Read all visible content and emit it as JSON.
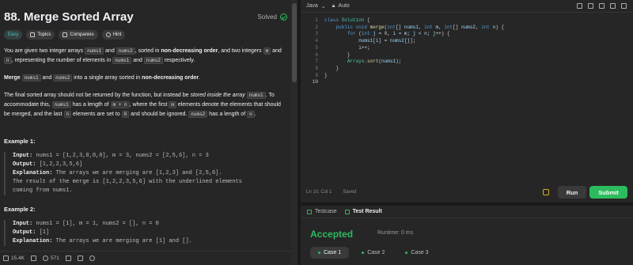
{
  "problem": {
    "title": "88. Merge Sorted Array",
    "solved_label": "Solved",
    "tags": [
      {
        "label": "Easy",
        "icon": ""
      },
      {
        "label": "Topics",
        "icon": "tag-icon"
      },
      {
        "label": "Companies",
        "icon": "building-icon"
      },
      {
        "label": "Hint",
        "icon": "lightbulb-icon"
      }
    ]
  },
  "description": {
    "p1_a": "You are given two integer arrays ",
    "p1_nums1": "nums1",
    "p1_b": " and ",
    "p1_nums2": "nums2",
    "p1_c": ", sorted in ",
    "p1_bold": "non-decreasing order",
    "p1_d": ", and two integers ",
    "p1_m": "m",
    "p1_e": " and ",
    "p1_n": "n",
    "p1_f": ", representing the number of elements in ",
    "p1_nums1b": "nums1",
    "p1_g": " and ",
    "p1_nums2b": "nums2",
    "p1_h": " respectively.",
    "p2_bold1": "Merge",
    "p2_nums1": "nums1",
    "p2_a": " and ",
    "p2_nums2": "nums2",
    "p2_bold2": " into a single array sorted in ",
    "p2_bold3": "non-decreasing order",
    "p2_end": ".",
    "p3_a": "The final sorted array should not be returned by the function, but instead be ",
    "p3_italic": "stored inside the array",
    "p3_nums1": "nums1",
    "p3_b": ". To accommodate this, ",
    "p3_nums1b": "nums1",
    "p3_c": " has a length of ",
    "p3_mn": "m + n",
    "p3_d": ", where the first ",
    "p3_m": "m",
    "p3_e": " elements denote the elements that should be merged, and the last ",
    "p3_n": "n",
    "p3_f": " elements are set to ",
    "p3_zero": "0",
    "p3_g": " and should be ignored. ",
    "p3_nums2": "nums2",
    "p3_h": " has a length of ",
    "p3_n2": "n",
    "p3_end": "."
  },
  "examples": [
    {
      "title": "Example 1:",
      "input_label": "Input:",
      "input": " nums1 = [1,2,3,0,0,0], m = 3, nums2 = [2,5,6], n = 3",
      "output_label": "Output:",
      "output": " [1,2,2,3,5,6]",
      "explanation_label": "Explanation:",
      "explanation": " The arrays we are merging are [1,2,3] and [2,5,6].",
      "explanation2": "The result of the merge is [1,2,2,3,5,6] with the underlined elements",
      "explanation3": "coming from nums1."
    },
    {
      "title": "Example 2:",
      "input_label": "Input:",
      "input": " nums1 = [1], m = 1, nums2 = [], n = 0",
      "output_label": "Output:",
      "output": " [1]",
      "explanation_label": "Explanation:",
      "explanation": " The arrays we are merging are [1] and []."
    }
  ],
  "footer": {
    "likes": "15.4K",
    "comments": "571"
  },
  "editor": {
    "language": "Java",
    "mode": "Auto",
    "cursor": "Ln 10, Col 1",
    "saved": "Saved",
    "line_numbers": [
      "1",
      "2",
      "3",
      "4",
      "5",
      "6",
      "7",
      "8",
      "9",
      "10"
    ]
  },
  "buttons": {
    "run": "Run",
    "submit": "Submit"
  },
  "result": {
    "tab_testcase": "Testcase",
    "tab_result": "Test Result",
    "status": "Accepted",
    "runtime": "Runtime: 0 ms",
    "cases": [
      "Case 1",
      "Case 2",
      "Case 3"
    ]
  },
  "colors": {
    "accent_green": "#2cbb5d",
    "easy": "#46c6c2",
    "background": "#262626"
  }
}
